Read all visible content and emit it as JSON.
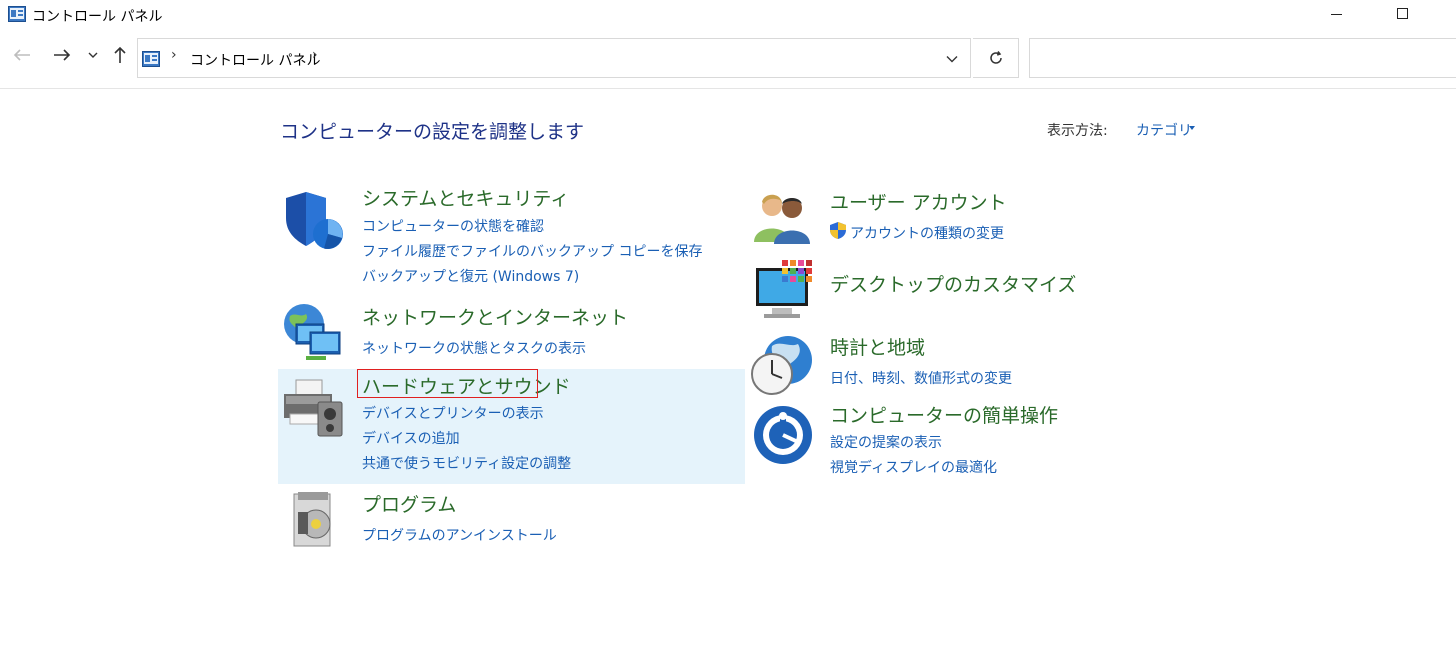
{
  "window": {
    "title": "コントロール パネル",
    "icon": "control-panel-icon"
  },
  "nav": {
    "back_icon": "arrow-left-icon",
    "forward_icon": "arrow-right-icon",
    "recent_icon": "chevron-down-icon",
    "up_icon": "arrow-up-icon",
    "refresh_icon": "refresh-icon",
    "address": {
      "location": "コントロール パネル",
      "separator": "›"
    },
    "search": {
      "value": "",
      "placeholder": ""
    }
  },
  "header": {
    "title": "コンピューターの設定を調整します",
    "view_by_label": "表示方法:",
    "view_by_value": "カテゴリ"
  },
  "categories": {
    "system_security": {
      "title": "システムとセキュリティ",
      "icon": "shield-icon",
      "links": [
        "コンピューターの状態を確認",
        "ファイル履歴でファイルのバックアップ コピーを保存",
        "バックアップと復元 (Windows 7)"
      ]
    },
    "network": {
      "title": "ネットワークとインターネット",
      "icon": "network-globe-icon",
      "links": [
        "ネットワークの状態とタスクの表示"
      ]
    },
    "hardware_sound": {
      "title": "ハードウェアとサウンド",
      "icon": "printer-icon",
      "links": [
        "デバイスとプリンターの表示",
        "デバイスの追加",
        "共通で使うモビリティ設定の調整"
      ]
    },
    "programs": {
      "title": "プログラム",
      "icon": "programs-icon",
      "links": [
        "プログラムのアンインストール"
      ]
    },
    "user_accounts": {
      "title": "ユーザー アカウント",
      "icon": "users-icon",
      "links": [
        "アカウントの種類の変更"
      ],
      "link_icon": "uac-shield-icon"
    },
    "appearance": {
      "title": "デスクトップのカスタマイズ",
      "icon": "monitor-icon",
      "links": []
    },
    "clock_region": {
      "title": "時計と地域",
      "icon": "clock-globe-icon",
      "links": [
        "日付、時刻、数値形式の変更"
      ]
    },
    "ease_of_access": {
      "title": "コンピューターの簡単操作",
      "icon": "ease-of-access-icon",
      "links": [
        "設定の提案の表示",
        "視覚ディスプレイの最適化"
      ]
    }
  },
  "colors": {
    "title_blue": "#1e3287",
    "category_green": "#2a6a2a",
    "link_blue": "#1a5fb4",
    "hover_bg": "#e5f3fb",
    "highlight_red": "#e02020"
  }
}
